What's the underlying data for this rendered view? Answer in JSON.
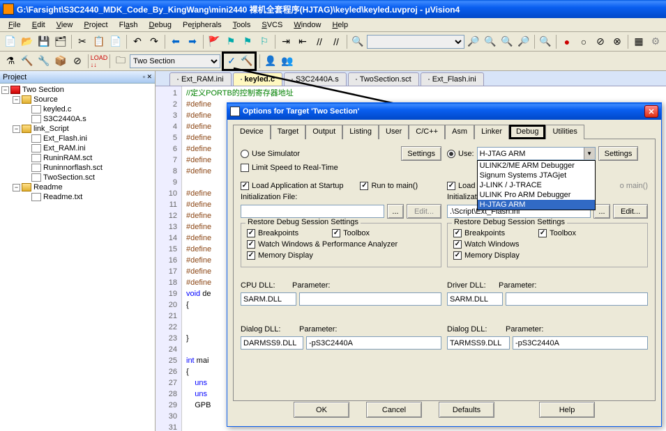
{
  "window": {
    "title": "G:\\Farsight\\S3C2440_MDK_Code_By_KingWang\\mini2440 裸机全套程序(HJTAG)\\keyled\\keyled.uvproj - μVision4"
  },
  "menu": {
    "items": [
      "File",
      "Edit",
      "View",
      "Project",
      "Flash",
      "Debug",
      "Peripherals",
      "Tools",
      "SVCS",
      "Window",
      "Help"
    ]
  },
  "toolbar2": {
    "combo": "Two Section"
  },
  "project_panel": {
    "title": "Project",
    "root": "Two Section",
    "source": "Source",
    "files_source": [
      "keyled.c",
      "S3C2440A.s"
    ],
    "link_script": "link_Script",
    "files_link": [
      "Ext_Flash.ini",
      "Ext_RAM.ini",
      "RuninRAM.sct",
      "Runinnorflash.sct",
      "TwoSection.sct"
    ],
    "readme": "Readme",
    "files_readme": [
      "Readme.txt"
    ]
  },
  "file_tabs": {
    "items": [
      "Ext_RAM.ini",
      "keyled.c",
      "S3C2440A.s",
      "TwoSection.sct",
      "Ext_Flash.ini"
    ],
    "active": 1
  },
  "code": {
    "comment": "//定义PORTB的控制寄存器地址",
    "lines": [
      "#define",
      "#define",
      "#define",
      "#define",
      "#define",
      "#define",
      "#define",
      "",
      "#define",
      "#define",
      "#define",
      "#define",
      "#define",
      "#define",
      "#define",
      "#define",
      "#define"
    ],
    "void_line": "void de",
    "brace_open": "{",
    "brace_close": "}",
    "int_main": "int mai",
    "uns1": "    uns",
    "uns2": "    uns",
    "gpb": "    GPB"
  },
  "dialog": {
    "title": "Options for Target 'Two Section'",
    "tabs": [
      "Device",
      "Target",
      "Output",
      "Listing",
      "User",
      "C/C++",
      "Asm",
      "Linker",
      "Debug",
      "Utilities"
    ],
    "active_tab": "Debug",
    "left": {
      "use_simulator": "Use Simulator",
      "settings": "Settings",
      "limit_speed": "Limit Speed to Real-Time",
      "load_app": "Load Application at Startup",
      "run_to_main": "Run to main()",
      "init_file_label": "Initialization File:",
      "init_file": "",
      "browse": "...",
      "edit": "Edit...",
      "restore_title": "Restore Debug Session Settings",
      "breakpoints": "Breakpoints",
      "toolbox": "Toolbox",
      "watch": "Watch Windows & Performance Analyzer",
      "memory": "Memory Display",
      "cpu_dll": "CPU DLL:",
      "cpu_dll_val": "SARM.DLL",
      "parameter": "Parameter:",
      "parameter_val": "",
      "dialog_dll": "Dialog DLL:",
      "dialog_dll_val": "DARMSS9.DLL",
      "dialog_param_val": "-pS3C2440A"
    },
    "right": {
      "use": "Use:",
      "debugger": "H-JTAG ARM",
      "settings": "Settings",
      "dropdown_items": [
        "ULINK2/ME ARM Debugger",
        "Signum Systems JTAGjet",
        "J-LINK / J-TRACE",
        "ULINK Pro ARM Debugger",
        "H-JTAG ARM"
      ],
      "load_app_partial": "Load",
      "run_to_main_partial": "o main()",
      "init_file_label_partial": "Initializati",
      "init_file": ".\\Script\\Ext_Flash.ini",
      "browse": "...",
      "edit": "Edit...",
      "restore_title": "Restore Debug Session Settings",
      "breakpoints": "Breakpoints",
      "toolbox": "Toolbox",
      "watch": "Watch Windows",
      "memory": "Memory Display",
      "driver_dll": "Driver DLL:",
      "driver_dll_val": "SARM.DLL",
      "parameter": "Parameter:",
      "parameter_val": "",
      "dialog_dll": "Dialog DLL:",
      "dialog_dll_val": "TARMSS9.DLL",
      "dialog_param_val": "-pS3C2440A"
    },
    "buttons": {
      "ok": "OK",
      "cancel": "Cancel",
      "defaults": "Defaults",
      "help": "Help"
    }
  }
}
